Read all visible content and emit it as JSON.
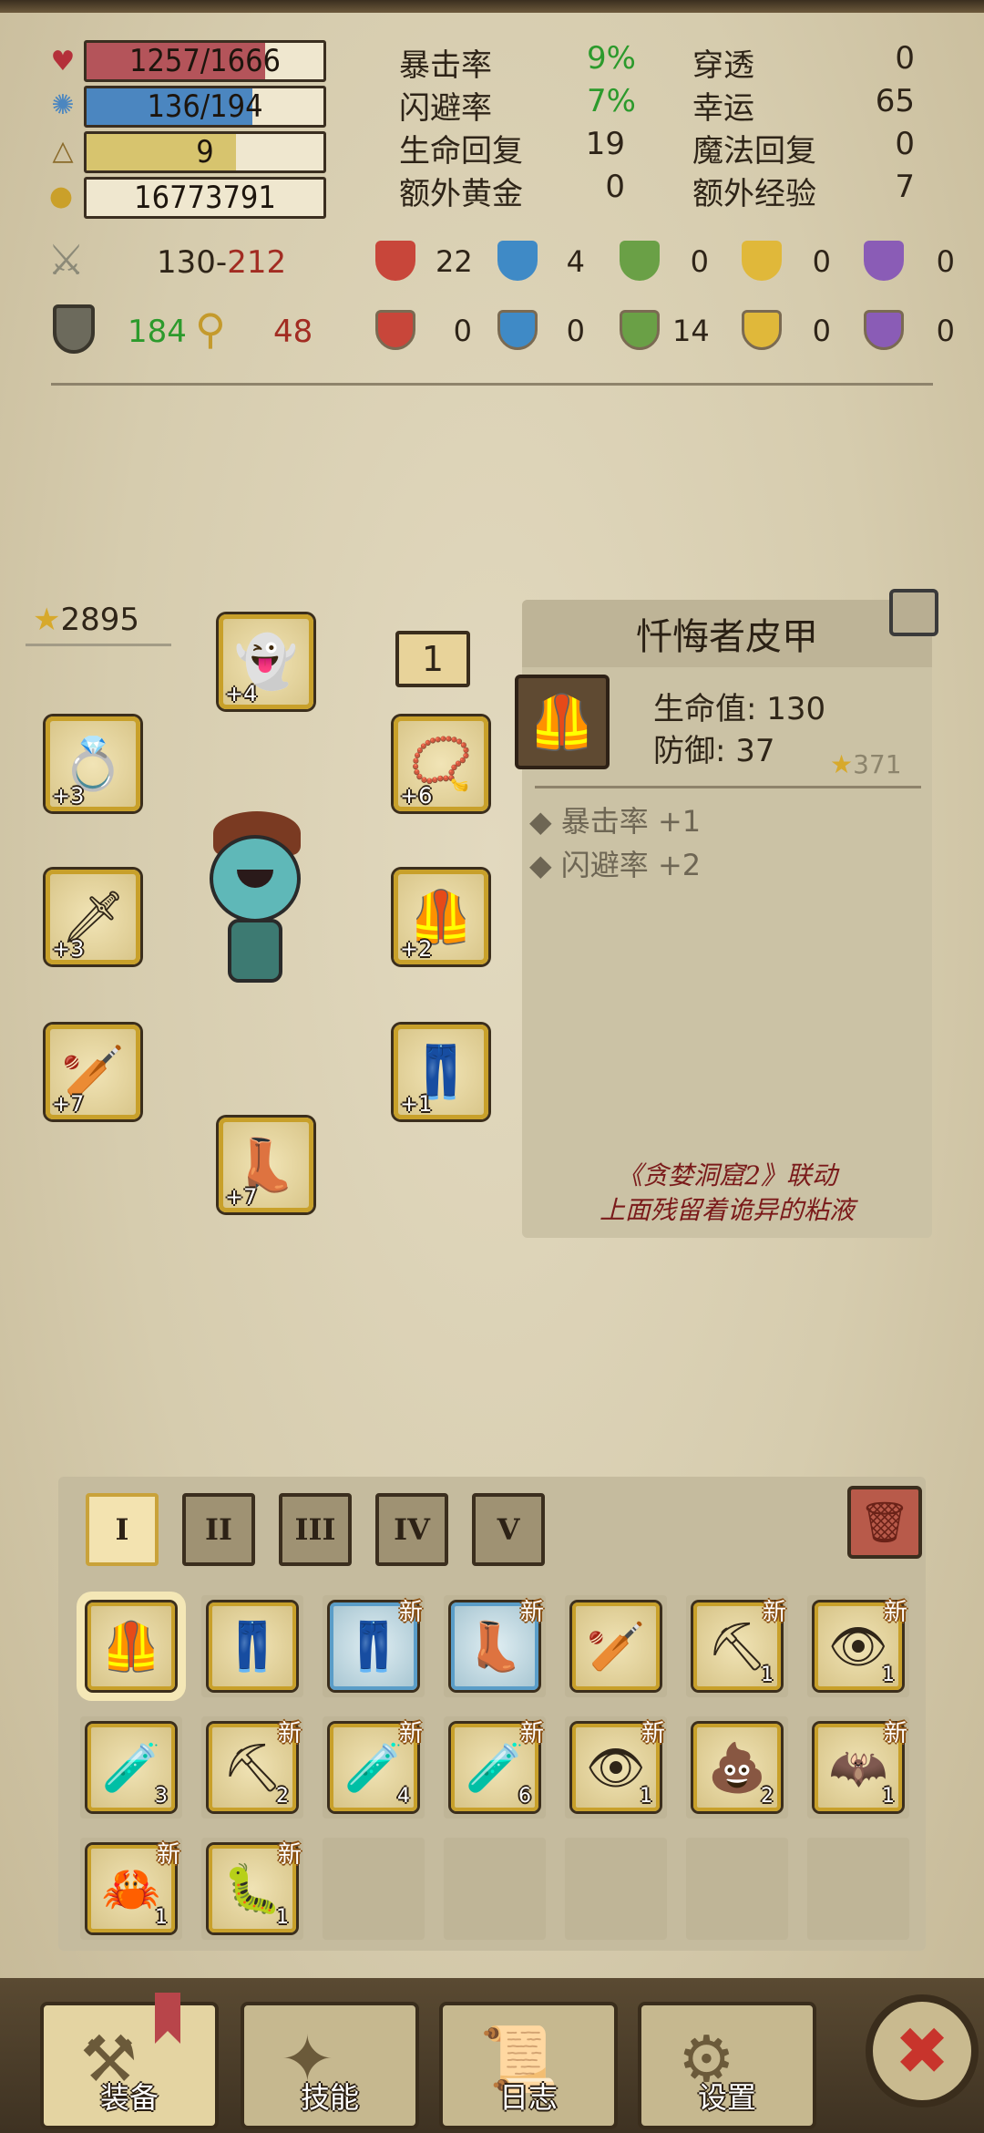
{
  "resources": {
    "hp": {
      "text": "1257/1666",
      "fill": 0.754,
      "color": "#b4545a"
    },
    "mp": {
      "text": "136/194",
      "fill": 0.701,
      "color": "#4b86c0"
    },
    "level": {
      "text": "9",
      "fill": 0.63,
      "color": "#d7c46e"
    },
    "gold": {
      "text": "16773791",
      "fill": 0,
      "color": "#efe7cf"
    }
  },
  "stats": {
    "left": [
      {
        "label": "暴击率",
        "value": "9%",
        "tone": "green"
      },
      {
        "label": "闪避率",
        "value": "7%",
        "tone": "green"
      },
      {
        "label": "生命回复",
        "value": "19",
        "tone": ""
      },
      {
        "label": "额外黄金",
        "value": "0",
        "tone": ""
      }
    ],
    "right": [
      {
        "label": "穿透",
        "value": "0"
      },
      {
        "label": "幸运",
        "value": "65"
      },
      {
        "label": "魔法回复",
        "value": "0"
      },
      {
        "label": "额外经验",
        "value": "7"
      }
    ]
  },
  "attack": {
    "min": "130",
    "sep": "-",
    "max": "212"
  },
  "defense": {
    "armor": "184",
    "magic": "48"
  },
  "elements_attack": [
    "22",
    "4",
    "0",
    "0",
    "0"
  ],
  "elements_defense": [
    "0",
    "0",
    "14",
    "0",
    "0"
  ],
  "colors": {
    "fire": "#c8463a",
    "water": "#3f8ac6",
    "nature": "#6aa046",
    "light": "#e0b83a",
    "arcane": "#8a5cb6"
  },
  "character": {
    "score": "2895",
    "bag_page": "1"
  },
  "equipment": {
    "pet": "+4",
    "ring": "+3",
    "amulet": "+6",
    "weapon": "+3",
    "armor": "+2",
    "offhand": "+7",
    "pants": "+1",
    "boots": "+7"
  },
  "item_info": {
    "name": "忏悔者皮甲",
    "hp_line": "生命值: 130",
    "def_line": "防御: 37",
    "score": "371",
    "bonuses": [
      "暴击率 +1",
      "闪避率 +2"
    ],
    "flavor_1": "《贪婪洞窟2》联动",
    "flavor_2": "上面残留着诡异的粘液"
  },
  "inventory": {
    "tabs": [
      "I",
      "II",
      "III",
      "IV",
      "V"
    ],
    "new_label": "新",
    "items": [
      {
        "icon": "armor-icon",
        "glyph": "🦺",
        "count": "",
        "new": false,
        "style": "selected"
      },
      {
        "icon": "skirt-icon",
        "glyph": "👖",
        "count": "",
        "new": false,
        "style": ""
      },
      {
        "icon": "pants-icon",
        "glyph": "👖",
        "count": "",
        "new": true,
        "style": "blue"
      },
      {
        "icon": "boots-icon",
        "glyph": "👢",
        "count": "",
        "new": true,
        "style": "blue"
      },
      {
        "icon": "spiked-club-icon",
        "glyph": "🏏",
        "count": "",
        "new": false,
        "style": ""
      },
      {
        "icon": "pickaxe-icon",
        "glyph": "⛏",
        "count": "1",
        "new": true,
        "style": ""
      },
      {
        "icon": "eye-scroll-icon",
        "glyph": "👁",
        "count": "1",
        "new": true,
        "style": ""
      },
      {
        "icon": "potion-yellow-icon",
        "glyph": "🧪",
        "count": "3",
        "new": false,
        "style": ""
      },
      {
        "icon": "pickaxe-icon",
        "glyph": "⛏",
        "count": "2",
        "new": true,
        "style": ""
      },
      {
        "icon": "potion-red-icon",
        "glyph": "🧪",
        "count": "4",
        "new": true,
        "style": ""
      },
      {
        "icon": "potion-blue-icon",
        "glyph": "🧪",
        "count": "6",
        "new": true,
        "style": ""
      },
      {
        "icon": "eye-scroll-icon",
        "glyph": "👁",
        "count": "1",
        "new": true,
        "style": ""
      },
      {
        "icon": "slime-icon",
        "glyph": "💩",
        "count": "2",
        "new": false,
        "style": ""
      },
      {
        "icon": "bat-wing-icon",
        "glyph": "🦇",
        "count": "1",
        "new": true,
        "style": ""
      },
      {
        "icon": "claw-icon",
        "glyph": "🦀",
        "count": "1",
        "new": true,
        "style": ""
      },
      {
        "icon": "worm-icon",
        "glyph": "🐛",
        "count": "1",
        "new": true,
        "style": ""
      }
    ]
  },
  "nav": [
    {
      "label": "装备",
      "icon": "axe-icon",
      "glyph": "⚒"
    },
    {
      "label": "技能",
      "icon": "star-icon",
      "glyph": "✦"
    },
    {
      "label": "日志",
      "icon": "book-icon",
      "glyph": "📜"
    },
    {
      "label": "设置",
      "icon": "gear-icon",
      "glyph": "⚙"
    }
  ]
}
